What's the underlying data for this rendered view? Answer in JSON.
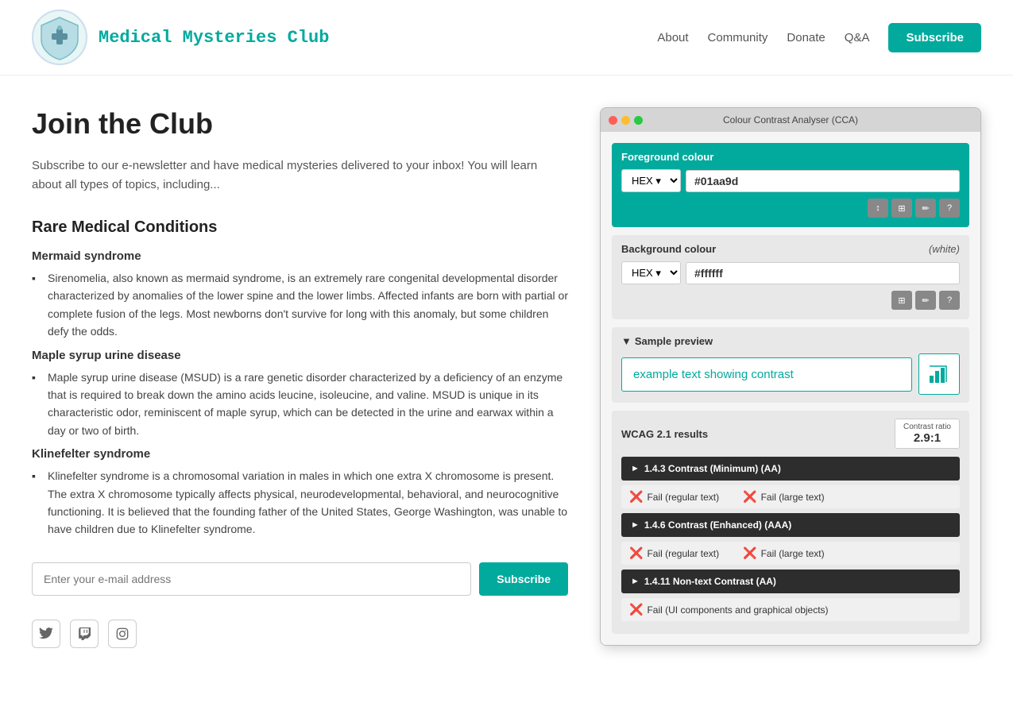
{
  "header": {
    "logo_alt": "Medical Mysteries Club Logo",
    "title": "Medical Mysteries Club",
    "nav": {
      "about": "About",
      "community": "Community",
      "donate": "Donate",
      "qa": "Q&A",
      "subscribe": "Subscribe"
    }
  },
  "main": {
    "heading": "Join the Club",
    "intro": "Subscribe to our e-newsletter and have medical mysteries delivered to your inbox! You will learn about all types of topics, including...",
    "section_heading": "Rare Medical Conditions",
    "conditions": [
      {
        "name": "Mermaid syndrome",
        "description": "Sirenomelia, also known as mermaid syndrome, is an extremely rare congenital developmental disorder characterized by anomalies of the lower spine and the lower limbs. Affected infants are born with partial or complete fusion of the legs. Most newborns don't survive for long with this anomaly, but some children defy the odds."
      },
      {
        "name": "Maple syrup urine disease",
        "description": "Maple syrup urine disease (MSUD) is a rare genetic disorder characterized by a deficiency of an enzyme that is required to break down the amino acids leucine, isoleucine, and valine. MSUD is unique in its characteristic odor, reminiscent of maple syrup, which can be detected in the urine and earwax within a day or two of birth."
      },
      {
        "name": "Klinefelter syndrome",
        "description": "Klinefelter syndrome is a chromosomal variation in males in which one extra X chromosome is present. The extra X chromosome typically affects physical, neurodevelopmental, behavioral, and neurocognitive functioning. It is believed that the founding father of the United States, George Washington, was unable to have children due to Klinefelter syndrome."
      }
    ],
    "email_placeholder": "Enter your e-mail address",
    "subscribe_btn": "Subscribe"
  },
  "cca": {
    "title": "Colour Contrast Analyser (CCA)",
    "foreground_label": "Foreground colour",
    "fg_format": "HEX",
    "fg_value": "#01aa9d",
    "background_label": "Background colour",
    "bg_white_label": "(white)",
    "bg_format": "HEX",
    "bg_value": "#ffffff",
    "preview_label": "▼ Sample preview",
    "example_text": "example text showing contrast",
    "wcag_label": "WCAG 2.1 results",
    "contrast_ratio_label": "Contrast ratio",
    "contrast_ratio_value": "2.9:1",
    "criteria": [
      {
        "label": "1.4.3 Contrast (Minimum) (AA)",
        "results": [
          {
            "label": "Fail (regular text)"
          },
          {
            "label": "Fail (large text)"
          }
        ]
      },
      {
        "label": "1.4.6 Contrast (Enhanced) (AAA)",
        "results": [
          {
            "label": "Fail (regular text)"
          },
          {
            "label": "Fail (large text)"
          }
        ]
      },
      {
        "label": "1.4.11 Non-text Contrast (AA)",
        "results": [
          {
            "label": "Fail (UI components and graphical objects)"
          }
        ]
      }
    ],
    "toolbar_fg": [
      "↕",
      "⊞",
      "✏",
      "?"
    ],
    "toolbar_bg": [
      "⊞",
      "✏",
      "?"
    ]
  },
  "social": {
    "twitter_label": "Twitter",
    "twitch_label": "Twitch",
    "instagram_label": "Instagram"
  }
}
